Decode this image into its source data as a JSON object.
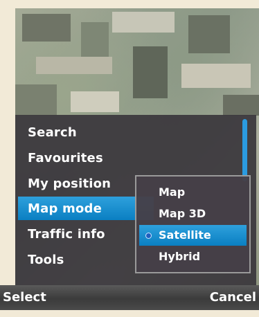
{
  "menu": {
    "items": [
      {
        "label": "Search"
      },
      {
        "label": "Favourites"
      },
      {
        "label": "My position"
      },
      {
        "label": "Map mode"
      },
      {
        "label": "Traffic info"
      },
      {
        "label": "Tools"
      }
    ],
    "selected_index": 3
  },
  "submenu": {
    "items": [
      {
        "label": "Map"
      },
      {
        "label": "Map 3D"
      },
      {
        "label": "Satellite"
      },
      {
        "label": "Hybrid"
      }
    ],
    "selected_index": 2
  },
  "softkeys": {
    "left_label": "Select",
    "right_label": "Cancel"
  },
  "colors": {
    "highlight": "#1a8fd3",
    "panel": "#3a363c",
    "softkey_bar": "#454545"
  },
  "icons": {
    "selected_radio": "radio-dot-icon"
  }
}
